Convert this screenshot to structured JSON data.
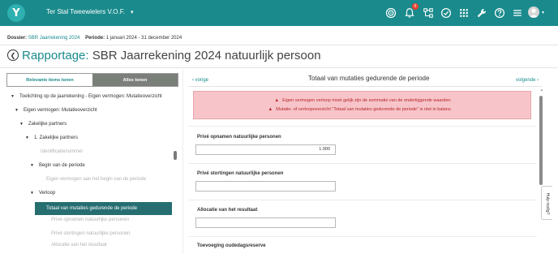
{
  "header": {
    "logo_letter": "Y",
    "company": "Ter Stal Tweewielers V.O.F.",
    "notification_count": "6",
    "icons": [
      "target-icon",
      "bell-icon",
      "org-chart-icon",
      "check-circle-icon",
      "apps-grid-icon",
      "wrench-icon",
      "help-icon",
      "menu-icon",
      "avatar",
      "chevron-down-icon"
    ]
  },
  "dossier": {
    "dossier_label": "Dossier:",
    "dossier_value": "SBR Jaarrekening 2024",
    "periode_label": "Periode:",
    "periode_value": "1 januari 2024 - 31 december 2024"
  },
  "page": {
    "title_prefix": "Rapportage:",
    "title_rest": "SBR Jaarrekening 2024 natuurlijk persoon"
  },
  "left_panel": {
    "toggle_relevant": "Relevante items tonen",
    "toggle_all": "Alles tonen",
    "tree": [
      {
        "label": "Toelichting op de jaarrekening - Eigen vermogen: Mutatieoverzicht",
        "level": 0,
        "expanded": true,
        "muted": false
      },
      {
        "label": "Eigen vermogen: Mutatieoverzicht",
        "level": 1,
        "expanded": true,
        "muted": false
      },
      {
        "label": "Zakelijke partners",
        "level": 2,
        "expanded": true,
        "muted": false
      },
      {
        "label": "1. Zakelijke partners",
        "level": 3,
        "expanded": true,
        "muted": false
      },
      {
        "label": "Identificatienummer",
        "level": 4,
        "expanded": false,
        "muted": true
      },
      {
        "label": "Begin van de periode",
        "level": 4,
        "expanded": true,
        "muted": false
      },
      {
        "label": "Eigen vermogen aan het begin van de periode",
        "level": 5,
        "expanded": false,
        "muted": true
      },
      {
        "label": "Verloop",
        "level": 4,
        "expanded": true,
        "muted": false
      },
      {
        "label": "Totaal van mutaties gedurende de periode",
        "level": 5,
        "expanded": false,
        "muted": false,
        "active": true
      },
      {
        "label": "Privé opnamen natuurlijke personen",
        "level": 6,
        "expanded": false,
        "muted": true
      },
      {
        "label": "Privé stortingen natuurlijke personen",
        "level": 6,
        "expanded": false,
        "muted": true
      },
      {
        "label": "Allocatie van het resultaat",
        "level": 6,
        "expanded": false,
        "muted": true
      }
    ]
  },
  "right_panel": {
    "prev_label": "vorige",
    "next_label": "volgende",
    "title": "Totaal van mutaties gedurende de periode",
    "alerts": [
      "Eigen vermogen verloop moet gelijk zijn de sommatie van de onderliggende waarden.",
      "Mutatie- of verloopoverzicht \"Totaal van mutaties gedurende de periode\" is niet in balans."
    ],
    "fields": [
      {
        "label": "Privé opnamen natuurlijke personen",
        "value": "1.000"
      },
      {
        "label": "Privé stortingen natuurlijke personen",
        "value": ""
      },
      {
        "label": "Allocatie van het resultaat",
        "value": ""
      },
      {
        "label": "Toevoeging oudedagsreserve",
        "value": ""
      }
    ],
    "help_label": "Hulp nodig?"
  },
  "colors": {
    "brand": "#1a8a8c",
    "active_row": "#266e70",
    "alert_bg": "#f7c5c9",
    "alert_text": "#b5252c",
    "notification": "#e8412c"
  }
}
